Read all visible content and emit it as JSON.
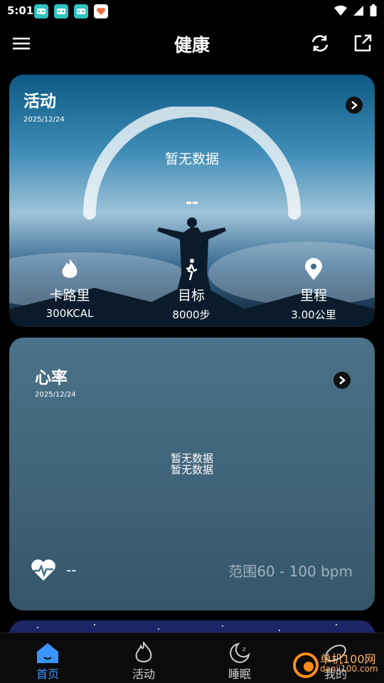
{
  "status_bar": {
    "time": "5:01"
  },
  "header": {
    "title": "健康"
  },
  "activity_card": {
    "title": "活动",
    "date": "2025/12/24",
    "no_data": "暂无数据",
    "value": "--",
    "stats": [
      {
        "icon": "flame-icon",
        "label": "卡路里",
        "value": "300KCAL"
      },
      {
        "icon": "walk-icon",
        "label": "目标",
        "value": "8000步"
      },
      {
        "icon": "location-pin-icon",
        "label": "里程",
        "value": "3.00公里"
      }
    ]
  },
  "heart_rate_card": {
    "title": "心率",
    "date": "2025/12/24",
    "no_data_1": "暂无数据",
    "no_data_2": "暂无数据",
    "value": "--",
    "range": "范围60 - 100 bpm"
  },
  "bottom_nav": {
    "items": [
      {
        "label": "首页",
        "icon": "home-icon",
        "active": true
      },
      {
        "label": "活动",
        "icon": "flame-icon",
        "active": false
      },
      {
        "label": "睡眠",
        "icon": "moon-icon",
        "active": false
      },
      {
        "label": "我的",
        "icon": "profile-icon",
        "active": false
      }
    ]
  },
  "watermark": {
    "text": "单机100网",
    "sub": "danji100.com"
  },
  "colors": {
    "active": "#3b94ff",
    "range_text": "#9fb2bf"
  }
}
